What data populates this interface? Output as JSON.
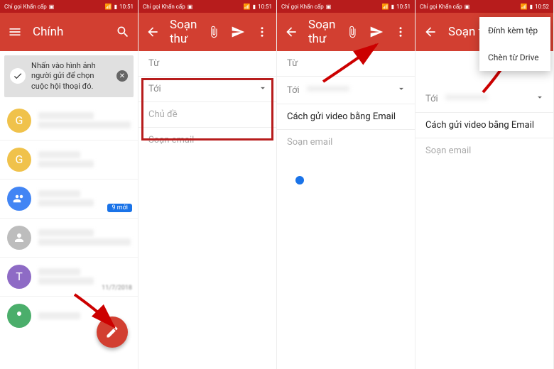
{
  "statusbar": {
    "call_label": "Chỉ gọi Khẩn cấp",
    "time": "10:51",
    "time4": "10:52"
  },
  "panel1": {
    "title": "Chính",
    "tip": "Nhấn vào hình ảnh người gửi để chọn cuộc hội thoại đó.",
    "badge": "9 mới",
    "date": "11/7/2018"
  },
  "compose": {
    "title": "Soạn thư",
    "from": "Từ",
    "to": "Tới",
    "subject_placeholder": "Chủ đề",
    "body_placeholder": "Soạn email",
    "subject_filled": "Cách gửi video bằng Email"
  },
  "menu": {
    "attach_file": "Đính kèm tệp",
    "insert_drive": "Chèn từ Drive"
  },
  "avatars": [
    {
      "letter": "G",
      "color": "#f0c24b"
    },
    {
      "letter": "G",
      "color": "#f0c24b"
    },
    {
      "letter": "",
      "color": "#4285f4",
      "icon": "people"
    },
    {
      "letter": "",
      "color": "#bdbdbd",
      "icon": "person"
    },
    {
      "letter": "T",
      "color": "#8e6bc5"
    },
    {
      "letter": "",
      "color": "#4bae6b",
      "icon": "person"
    }
  ]
}
